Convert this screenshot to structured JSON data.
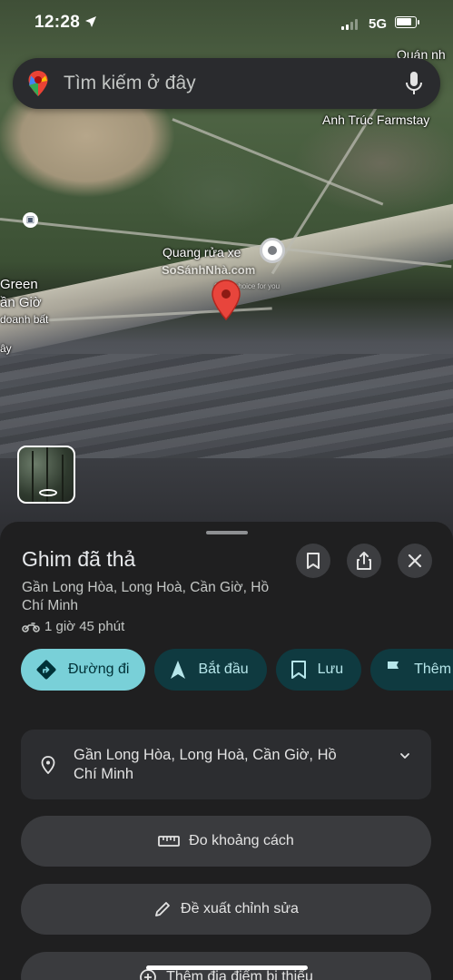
{
  "status_bar": {
    "time": "12:28",
    "network": "5G",
    "battery_level": 0.85
  },
  "search": {
    "placeholder": "Tìm kiếm ở đây",
    "icons": [
      "maps-pin-icon",
      "mic-icon"
    ]
  },
  "map": {
    "labels": {
      "top_right": "Quán nh",
      "farmstay": "Anh Trúc Farmstay",
      "car_wash": "Quang rửa xe",
      "watermark": "SoSánhNhà.com",
      "watermark_sub": "Great choice for you",
      "green": "Green",
      "can_gio": "ần Giờ",
      "doanh_bat": "doanh bất",
      "day": "ây"
    }
  },
  "sheet": {
    "title": "Ghim đã thả",
    "address": "Gần Long Hòa, Long Hoà, Cần Giờ, Hồ Chí Minh",
    "eta": "1 giờ 45 phút",
    "chips": [
      {
        "label": "Đường đi",
        "icon": "directions-icon"
      },
      {
        "label": "Bắt đầu",
        "icon": "navigation-arrow-icon"
      },
      {
        "label": "Lưu",
        "icon": "bookmark-icon"
      },
      {
        "label": "Thêm",
        "icon": "flag-icon"
      }
    ],
    "address_card": "Gần Long Hòa, Long Hoà, Cần Giờ, Hồ Chí Minh",
    "measure_label": "Đo khoảng cách",
    "suggest_edit_label": "Đề xuất chỉnh sửa",
    "add_missing_label": "Thêm địa điểm bị thiếu"
  },
  "colors": {
    "accent": "#79d0d8",
    "chip_dark": "#0f3a40",
    "pin_red": "#e8453c"
  }
}
